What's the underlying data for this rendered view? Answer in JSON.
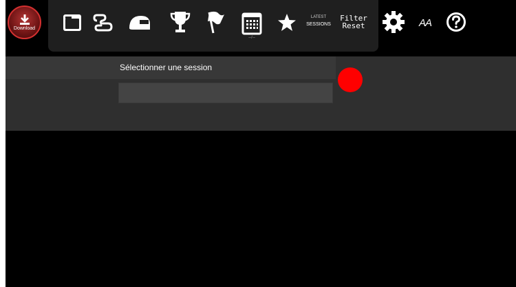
{
  "toolbar": {
    "download_label": "Download",
    "latest_line1": "LATEST",
    "latest_line2": "SESSIONS",
    "filter_line1": "Filter",
    "filter_line2": "Reset",
    "font_size_label": "AA",
    "calendar_caption": "--/--",
    "icons": [
      "download-icon",
      "folder-icon",
      "track-icon",
      "helmet-icon",
      "trophy-icon",
      "flag-icon",
      "calendar-icon",
      "star-icon",
      "gear-icon",
      "font-size-icon",
      "help-icon"
    ]
  },
  "session": {
    "label": "Sélectionner une session",
    "selected_value": ""
  },
  "colors": {
    "background": "#000000",
    "toolbar": "#1f1f1f",
    "panel": "#2f2f2f",
    "accent_red": "#ff0000",
    "download_red": "#b23434"
  }
}
